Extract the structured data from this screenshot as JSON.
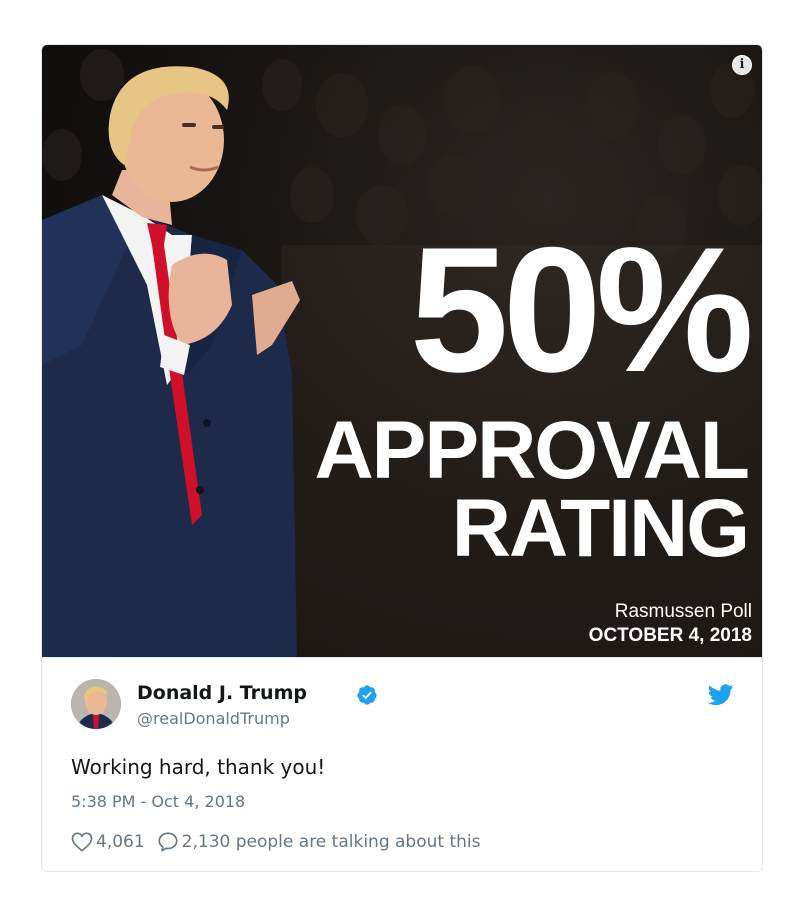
{
  "media": {
    "headline_number": "50%",
    "headline_line1": "APPROVAL",
    "headline_line2": "RATING",
    "poll_source": "Rasmussen Poll",
    "poll_date": "OCTOBER 4, 2018",
    "info_icon": "info-icon"
  },
  "tweet": {
    "author_name": "Donald J. Trump",
    "handle": "@realDonaldTrump",
    "verified_icon": "verified-badge-icon",
    "platform_icon": "twitter-bird-icon",
    "text": "Working hard, thank you!",
    "timestamp": "5:38 PM - Oct 4, 2018",
    "likes": "4,061",
    "conversation": "2,130 people are talking about this"
  },
  "colors": {
    "accent": "#1da1f2",
    "text_primary": "#14171a",
    "text_secondary": "#657786",
    "border": "#e1e8ed",
    "tie_red": "#d0102a",
    "suit_navy": "#1d2a4a"
  }
}
